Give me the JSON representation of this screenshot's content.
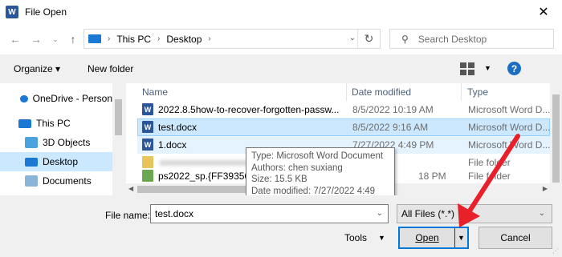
{
  "window": {
    "title": "File Open",
    "app_icon": "W"
  },
  "address": {
    "root": "This PC",
    "sep": "›",
    "folder": "Desktop"
  },
  "search": {
    "placeholder": "Search Desktop"
  },
  "toolbar": {
    "organize": "Organize ▾",
    "new_folder": "New folder"
  },
  "sidebar": {
    "items": [
      {
        "label": "OneDrive - Person",
        "icon": "cloud-icon",
        "color": "#1b79d4"
      },
      {
        "label": "This PC",
        "icon": "pc-icon",
        "color": "#1b79d4"
      },
      {
        "label": "3D Objects",
        "icon": "cube-icon",
        "color": "#4aa3df"
      },
      {
        "label": "Desktop",
        "icon": "desktop-icon",
        "color": "#1b79d4"
      },
      {
        "label": "Documents",
        "icon": "documents-icon",
        "color": "#8ab4d8"
      }
    ]
  },
  "columns": {
    "name": "Name",
    "date": "Date modified",
    "type": "Type"
  },
  "files": [
    {
      "name": "2022.8.5how-to-recover-forgotten-passw...",
      "date": "8/5/2022 10:19 AM",
      "type": "Microsoft Word D...",
      "icon": "word-doc-icon"
    },
    {
      "name": "test.docx",
      "date": "8/5/2022 9:16 AM",
      "type": "Microsoft Word D...",
      "icon": "word-doc-icon"
    },
    {
      "name": "1.docx",
      "date": "7/27/2022 4:49 PM",
      "type": "Microsoft Word D...",
      "icon": "word-doc-icon"
    },
    {
      "name": "",
      "date": "",
      "type": "File folder",
      "icon": "folder-icon"
    },
    {
      "name": "ps2022_sp.{FF393560",
      "date": "18 PM",
      "type": "File folder",
      "icon": "setup-icon"
    }
  ],
  "tooltip": {
    "type": "Type: Microsoft Word Document",
    "authors": "Authors: chen suxiang",
    "size": "Size: 15.5 KB",
    "modified": "Date modified: 7/27/2022 4:49 PM"
  },
  "bottom": {
    "filename_label": "File name:",
    "filename_value": "test.docx",
    "filter": "All Files (*.*)",
    "tools": "Tools",
    "open": "Open",
    "cancel": "Cancel"
  },
  "colors": {
    "selection": "#cce8ff",
    "accent": "#0078d7",
    "annotation_arrow": "#e8202a"
  }
}
